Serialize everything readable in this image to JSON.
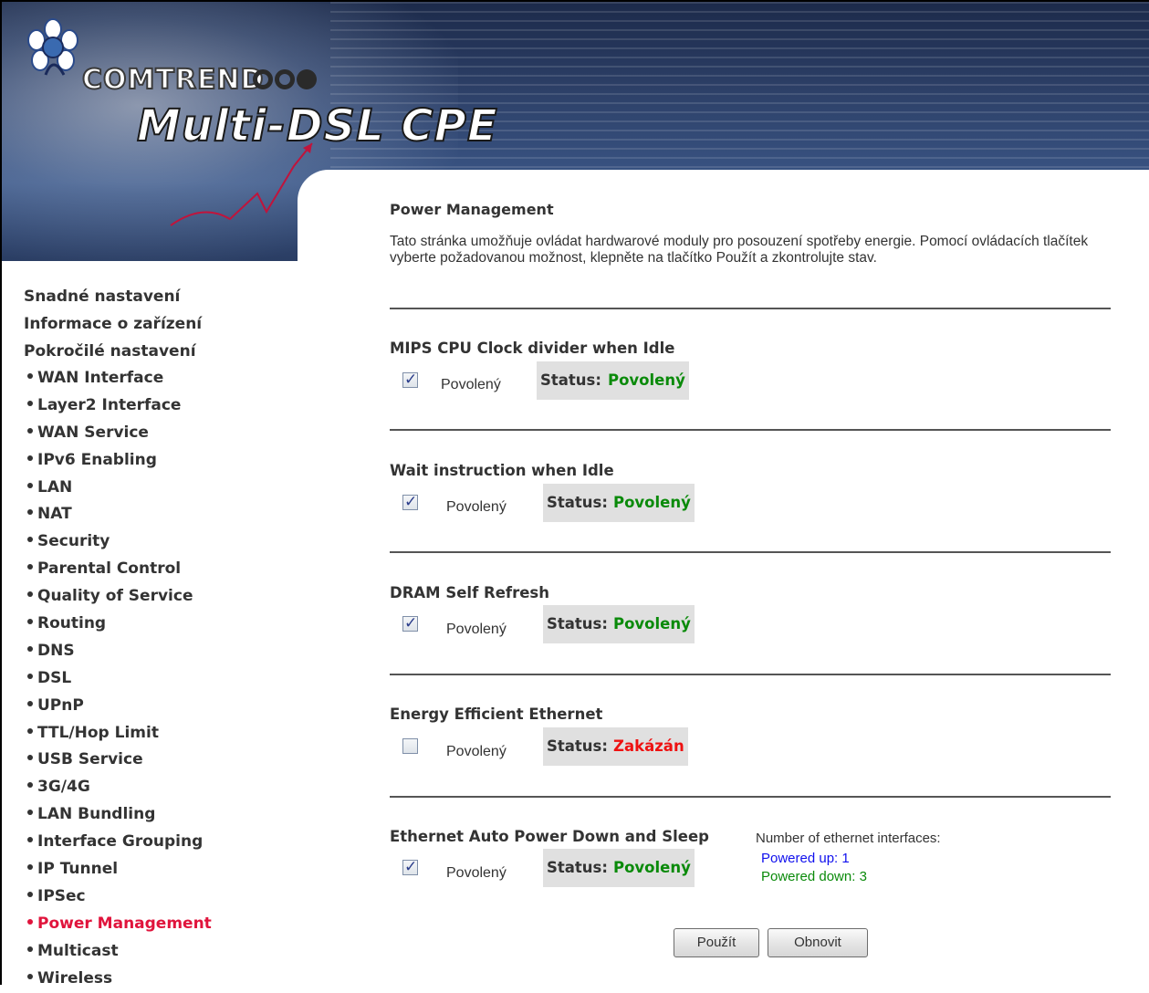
{
  "header": {
    "brand": "COMTREND",
    "product": "Multi-DSL CPE"
  },
  "sidebar": {
    "top_items": [
      {
        "label": "Snadné nastavení"
      },
      {
        "label": "Informace o zařízení"
      },
      {
        "label": "Pokročilé nastavení"
      }
    ],
    "sub_items": [
      {
        "label": "WAN Interface"
      },
      {
        "label": "Layer2 Interface"
      },
      {
        "label": "WAN Service"
      },
      {
        "label": "IPv6 Enabling"
      },
      {
        "label": "LAN"
      },
      {
        "label": "NAT"
      },
      {
        "label": "Security"
      },
      {
        "label": "Parental Control"
      },
      {
        "label": "Quality of Service"
      },
      {
        "label": "Routing"
      },
      {
        "label": "DNS"
      },
      {
        "label": "DSL"
      },
      {
        "label": "UPnP"
      },
      {
        "label": "TTL/Hop Limit"
      },
      {
        "label": "USB Service"
      },
      {
        "label": "3G/4G"
      },
      {
        "label": "LAN Bundling"
      },
      {
        "label": "Interface Grouping"
      },
      {
        "label": "IP Tunnel"
      },
      {
        "label": "IPSec"
      },
      {
        "label": "Power Management",
        "active": true
      },
      {
        "label": "Multicast"
      },
      {
        "label": "Wireless"
      }
    ],
    "active_color": "#e0143c"
  },
  "main": {
    "title": "Power Management",
    "description": "Tato stránka umožňuje ovládat hardwarové moduly pro posouzení spotřeby energie. Pomocí ovládacích tlačítek vyberte požadovanou možnost, klepněte na tlačítko Použít a zkontrolujte stav.",
    "sections": [
      {
        "title": "MIPS CPU Clock divider when Idle",
        "checkbox_label": "Povolený",
        "checked": true,
        "status_key": "Status:",
        "status_value": "Povolený"
      },
      {
        "title": "Wait instruction when Idle",
        "checkbox_label": "Povolený",
        "checked": true,
        "status_key": "Status:",
        "status_value": "Povolený"
      },
      {
        "title": "DRAM Self Refresh",
        "checkbox_label": "Povolený",
        "checked": true,
        "status_key": "Status:",
        "status_value": "Povolený"
      },
      {
        "title": "Energy Efficient Ethernet",
        "checkbox_label": "Povolený",
        "checked": false,
        "status_key": "Status:",
        "status_value": "Zakázán"
      },
      {
        "title": "Ethernet Auto Power Down and Sleep",
        "checkbox_label": "Povolený",
        "checked": true,
        "status_key": "Status:",
        "status_value": "Povolený"
      }
    ],
    "ethernet": {
      "count_label": "Number of ethernet interfaces:",
      "powered_up": "Powered up: 1",
      "powered_down": "Powered down: 3"
    },
    "buttons": {
      "apply": "Použít",
      "refresh": "Obnovit"
    },
    "colors": {
      "enabled": "#0a8a0a",
      "disabled": "#ee1111",
      "powered_up": "#1010ee"
    }
  }
}
